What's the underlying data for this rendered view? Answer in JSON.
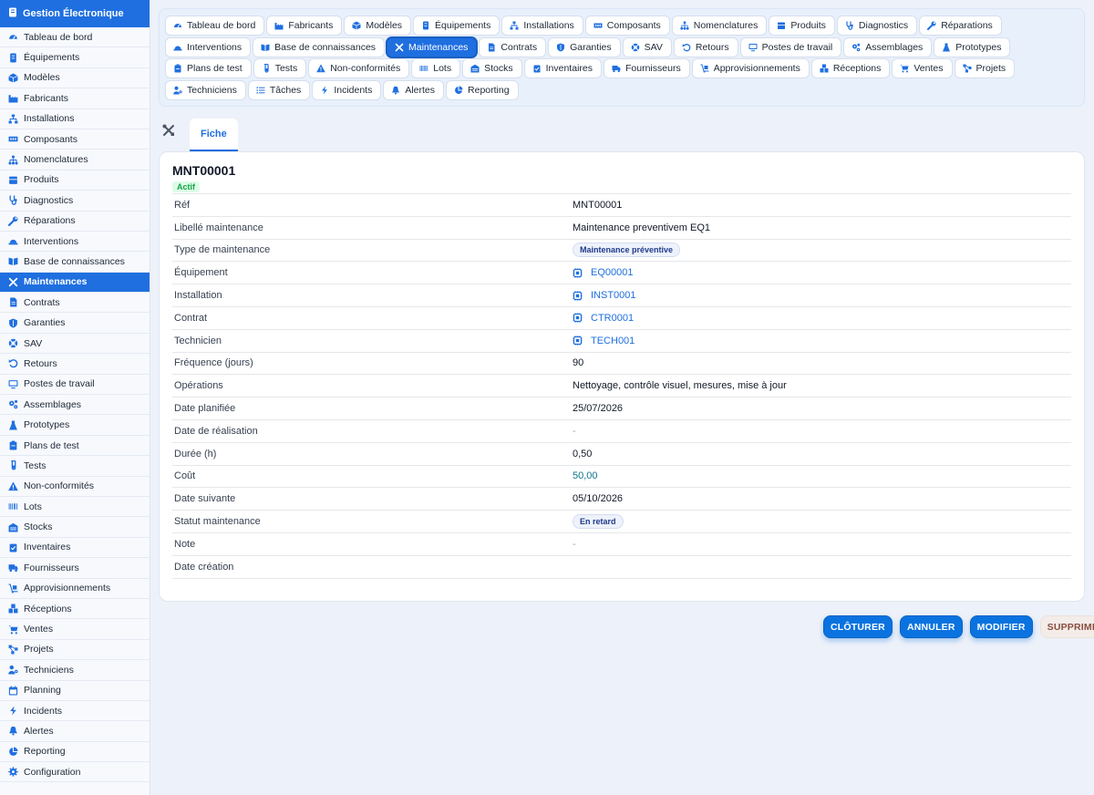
{
  "app": {
    "title": "Gestion Électronique"
  },
  "sidebar": {
    "items": [
      {
        "label": "Tableau de bord",
        "icon": "gauge-icon"
      },
      {
        "label": "Équipements",
        "icon": "server-icon"
      },
      {
        "label": "Modèles",
        "icon": "cube-icon"
      },
      {
        "label": "Fabricants",
        "icon": "factory-icon"
      },
      {
        "label": "Installations",
        "icon": "sitemap-icon"
      },
      {
        "label": "Composants",
        "icon": "memory-icon"
      },
      {
        "label": "Nomenclatures",
        "icon": "hierarchy-icon"
      },
      {
        "label": "Produits",
        "icon": "box-icon"
      },
      {
        "label": "Diagnostics",
        "icon": "stethoscope-icon"
      },
      {
        "label": "Réparations",
        "icon": "wrench-icon"
      },
      {
        "label": "Interventions",
        "icon": "hardhat-icon"
      },
      {
        "label": "Base de connaissances",
        "icon": "book-icon"
      },
      {
        "label": "Maintenances",
        "icon": "tools-icon",
        "active": true
      },
      {
        "label": "Contrats",
        "icon": "file-icon"
      },
      {
        "label": "Garanties",
        "icon": "shield-icon"
      },
      {
        "label": "SAV",
        "icon": "lifering-icon"
      },
      {
        "label": "Retours",
        "icon": "undo-icon"
      },
      {
        "label": "Postes de travail",
        "icon": "monitor-icon"
      },
      {
        "label": "Assemblages",
        "icon": "cogs-icon"
      },
      {
        "label": "Prototypes",
        "icon": "flask-icon"
      },
      {
        "label": "Plans de test",
        "icon": "clipboard-icon"
      },
      {
        "label": "Tests",
        "icon": "vial-icon"
      },
      {
        "label": "Non-conformités",
        "icon": "warning-icon"
      },
      {
        "label": "Lots",
        "icon": "barcode-icon"
      },
      {
        "label": "Stocks",
        "icon": "warehouse-icon"
      },
      {
        "label": "Inventaires",
        "icon": "clipboard-check-icon"
      },
      {
        "label": "Fournisseurs",
        "icon": "truck-icon"
      },
      {
        "label": "Approvisionnements",
        "icon": "dolly-icon"
      },
      {
        "label": "Réceptions",
        "icon": "boxes-icon"
      },
      {
        "label": "Ventes",
        "icon": "cart-icon"
      },
      {
        "label": "Projets",
        "icon": "project-icon"
      },
      {
        "label": "Techniciens",
        "icon": "users-cog-icon"
      },
      {
        "label": "Planning",
        "icon": "calendar-icon"
      },
      {
        "label": "Incidents",
        "icon": "bolt-icon"
      },
      {
        "label": "Alertes",
        "icon": "bell-icon"
      },
      {
        "label": "Reporting",
        "icon": "pie-chart-icon"
      },
      {
        "label": "Configuration",
        "icon": "gear-icon"
      }
    ]
  },
  "tabs": [
    {
      "label": "Tableau de bord",
      "icon": "gauge-icon"
    },
    {
      "label": "Fabricants",
      "icon": "factory-icon"
    },
    {
      "label": "Modèles",
      "icon": "cube-icon"
    },
    {
      "label": "Équipements",
      "icon": "server-icon"
    },
    {
      "label": "Installations",
      "icon": "sitemap-icon"
    },
    {
      "label": "Composants",
      "icon": "memory-icon"
    },
    {
      "label": "Nomenclatures",
      "icon": "hierarchy-icon"
    },
    {
      "label": "Produits",
      "icon": "box-icon"
    },
    {
      "label": "Diagnostics",
      "icon": "stethoscope-icon"
    },
    {
      "label": "Réparations",
      "icon": "wrench-icon"
    },
    {
      "label": "Interventions",
      "icon": "hardhat-icon"
    },
    {
      "label": "Base de connaissances",
      "icon": "book-icon"
    },
    {
      "label": "Maintenances",
      "icon": "tools-icon",
      "active": true
    },
    {
      "label": "Contrats",
      "icon": "file-icon"
    },
    {
      "label": "Garanties",
      "icon": "shield-icon"
    },
    {
      "label": "SAV",
      "icon": "lifering-icon"
    },
    {
      "label": "Retours",
      "icon": "undo-icon"
    },
    {
      "label": "Postes de travail",
      "icon": "monitor-icon"
    },
    {
      "label": "Assemblages",
      "icon": "cogs-icon"
    },
    {
      "label": "Prototypes",
      "icon": "flask-icon"
    },
    {
      "label": "Plans de test",
      "icon": "clipboard-icon"
    },
    {
      "label": "Tests",
      "icon": "vial-icon"
    },
    {
      "label": "Non-conformités",
      "icon": "warning-icon"
    },
    {
      "label": "Lots",
      "icon": "barcode-icon"
    },
    {
      "label": "Stocks",
      "icon": "warehouse-icon"
    },
    {
      "label": "Inventaires",
      "icon": "clipboard-check-icon"
    },
    {
      "label": "Fournisseurs",
      "icon": "truck-icon"
    },
    {
      "label": "Approvisionnements",
      "icon": "dolly-icon"
    },
    {
      "label": "Réceptions",
      "icon": "boxes-icon"
    },
    {
      "label": "Ventes",
      "icon": "cart-icon"
    },
    {
      "label": "Projets",
      "icon": "project-icon"
    },
    {
      "label": "Techniciens",
      "icon": "users-cog-icon"
    },
    {
      "label": "Tâches",
      "icon": "list-icon"
    },
    {
      "label": "Incidents",
      "icon": "bolt-icon"
    },
    {
      "label": "Alertes",
      "icon": "bell-icon"
    },
    {
      "label": "Reporting",
      "icon": "pie-chart-icon"
    }
  ],
  "subtabs": {
    "fiche": "Fiche"
  },
  "record": {
    "title": "MNT00001",
    "status": "Actif",
    "fields": [
      {
        "label": "Réf",
        "value": "MNT00001",
        "kind": "text"
      },
      {
        "label": "Libellé maintenance",
        "value": "Maintenance preventivem EQ1",
        "kind": "text"
      },
      {
        "label": "Type de maintenance",
        "value": "Maintenance préventive",
        "kind": "badge"
      },
      {
        "label": "Équipement",
        "value": "EQ00001",
        "kind": "link"
      },
      {
        "label": "Installation",
        "value": "INST0001",
        "kind": "link"
      },
      {
        "label": "Contrat",
        "value": "CTR0001",
        "kind": "link"
      },
      {
        "label": "Technicien",
        "value": "TECH001",
        "kind": "link"
      },
      {
        "label": "Fréquence (jours)",
        "value": "90",
        "kind": "text"
      },
      {
        "label": "Opérations",
        "value": "Nettoyage, contrôle visuel, mesures, mise à jour",
        "kind": "text"
      },
      {
        "label": "Date planifiée",
        "value": "25/07/2026",
        "kind": "text"
      },
      {
        "label": "Date de réalisation",
        "value": "-",
        "kind": "muted"
      },
      {
        "label": "Durée (h)",
        "value": "0,50",
        "kind": "text"
      },
      {
        "label": "Coût",
        "value": "50,00",
        "kind": "accent"
      },
      {
        "label": "Date suivante",
        "value": "05/10/2026",
        "kind": "text"
      },
      {
        "label": "Statut maintenance",
        "value": "En retard",
        "kind": "badge"
      },
      {
        "label": "Note",
        "value": "-",
        "kind": "muted"
      },
      {
        "label": "Date création",
        "value": "",
        "kind": "text"
      }
    ]
  },
  "actions": {
    "close": "CLÔTURER",
    "cancel": "ANNULER",
    "edit": "MODIFIER",
    "delete": "SUPPRIMER"
  },
  "colors": {
    "accent": "#1f6fe0",
    "success": "#16a34a",
    "danger_text": "#8a4d3f"
  }
}
